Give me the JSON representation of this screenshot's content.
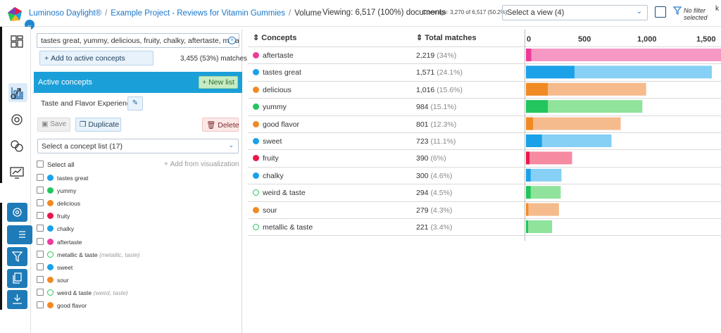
{
  "app": {
    "name": "Luminoso Daylight®",
    "project": "Example Project - Reviews for Vitamin Gummies",
    "page": "Volume"
  },
  "header": {
    "viewing": "Viewing: 6,517 (100%) documents",
    "coverage": "Coverage: 3,270 of 6,517 (50.2%)",
    "view_select": "Select a view (4)",
    "no_filter": "No filter selected",
    "edge_letter": "k"
  },
  "rail": {
    "icons": [
      "galaxy-icon",
      "volume-icon",
      "drivers-icon",
      "outliers-icon",
      "sentiment-icon",
      "compass-icon",
      "settings-icon",
      "concept-list-icon",
      "filter-icon",
      "documents-icon",
      "download-icon"
    ]
  },
  "panel": {
    "search_value": "tastes great, yummy, delicious, fruity, chalky, aftertaste, metalli",
    "add_label": "Add to active concepts",
    "matches": "3,455 (53%) matches",
    "active_title": "Active concepts",
    "new_list": "New list",
    "list_name": "Taste and Flavor Experience",
    "save": "Save",
    "duplicate": "Duplicate",
    "delete": "Delete",
    "list_select": "Select a concept list (17)",
    "select_all": "Select all",
    "add_from_viz": "Add from visualization",
    "concepts": [
      {
        "label": "tastes great",
        "hint": "",
        "color": "#1ba1e8",
        "marker": "dot"
      },
      {
        "label": "yummy",
        "hint": "",
        "color": "#22c55e",
        "marker": "dot"
      },
      {
        "label": "delicious",
        "hint": "",
        "color": "#f08a24",
        "marker": "dot"
      },
      {
        "label": "fruity",
        "hint": "",
        "color": "#e8194a",
        "marker": "dot"
      },
      {
        "label": "chalky",
        "hint": "",
        "color": "#1ba1e8",
        "marker": "dot"
      },
      {
        "label": "aftertaste",
        "hint": "",
        "color": "#ee3a9a",
        "marker": "dot"
      },
      {
        "label": "metallic & taste",
        "hint": "(metallic, taste)",
        "color": "#2ec45a",
        "marker": "ring"
      },
      {
        "label": "sweet",
        "hint": "",
        "color": "#1ba1e8",
        "marker": "dot"
      },
      {
        "label": "sour",
        "hint": "",
        "color": "#f08a24",
        "marker": "dot"
      },
      {
        "label": "weird & taste",
        "hint": "(weird, taste)",
        "color": "#2ec45a",
        "marker": "ring"
      },
      {
        "label": "good flavor",
        "hint": "",
        "color": "#f08a24",
        "marker": "dot"
      }
    ]
  },
  "table": {
    "col_concepts": "Concepts",
    "col_matches": "Total matches"
  },
  "chart_data": {
    "type": "bar",
    "orientation": "horizontal",
    "stacked": true,
    "xlim": [
      0,
      1650
    ],
    "ticks": [
      "0",
      "500",
      "1,000",
      "1,500"
    ],
    "tick_values": [
      0,
      500,
      1000,
      1500
    ],
    "rows": [
      {
        "label": "aftertaste",
        "total": 2219,
        "total_text": "2,219",
        "pct": "(34%)",
        "exact": 45,
        "color": "#ee3a9a",
        "light": "#f598c4",
        "marker": "dot"
      },
      {
        "label": "tastes great",
        "total": 1571,
        "total_text": "1,571",
        "pct": "(24.1%)",
        "exact": 410,
        "color": "#1ba1e8",
        "light": "#86cff5",
        "marker": "dot"
      },
      {
        "label": "delicious",
        "total": 1016,
        "total_text": "1,016",
        "pct": "(15.6%)",
        "exact": 185,
        "color": "#f08a24",
        "light": "#f5bb8d",
        "marker": "dot"
      },
      {
        "label": "yummy",
        "total": 984,
        "total_text": "984",
        "pct": "(15.1%)",
        "exact": 185,
        "color": "#22c55e",
        "light": "#8fe39b",
        "marker": "dot"
      },
      {
        "label": "good flavor",
        "total": 801,
        "total_text": "801",
        "pct": "(12.3%)",
        "exact": 60,
        "color": "#f08a24",
        "light": "#f5bb8d",
        "marker": "dot"
      },
      {
        "label": "sweet",
        "total": 723,
        "total_text": "723",
        "pct": "(11.1%)",
        "exact": 135,
        "color": "#1ba1e8",
        "light": "#86cff5",
        "marker": "dot"
      },
      {
        "label": "fruity",
        "total": 390,
        "total_text": "390",
        "pct": "(6%)",
        "exact": 30,
        "color": "#e8194a",
        "light": "#f58aa0",
        "marker": "dot"
      },
      {
        "label": "chalky",
        "total": 300,
        "total_text": "300",
        "pct": "(4.6%)",
        "exact": 40,
        "color": "#1ba1e8",
        "light": "#86cff5",
        "marker": "dot"
      },
      {
        "label": "weird & taste",
        "total": 294,
        "total_text": "294",
        "pct": "(4.5%)",
        "exact": 40,
        "color": "#22c55e",
        "light": "#8fe39b",
        "marker": "ring"
      },
      {
        "label": "sour",
        "total": 279,
        "total_text": "279",
        "pct": "(4.3%)",
        "exact": 20,
        "color": "#f08a24",
        "light": "#f5bb8d",
        "marker": "dot"
      },
      {
        "label": "metallic & taste",
        "total": 221,
        "total_text": "221",
        "pct": "(3.4%)",
        "exact": 5,
        "color": "#22c55e",
        "light": "#8fe39b",
        "marker": "ring"
      }
    ]
  }
}
